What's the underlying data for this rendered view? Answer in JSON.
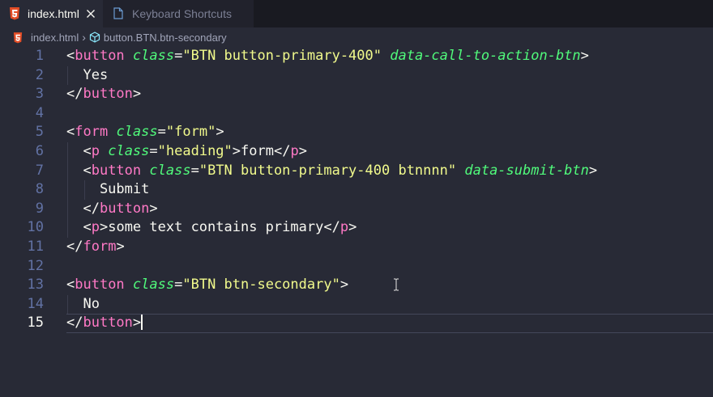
{
  "tabs": [
    {
      "label": "index.html",
      "active": true,
      "icon": "html5-icon"
    },
    {
      "label": "Keyboard Shortcuts",
      "active": false,
      "icon": "file-icon"
    }
  ],
  "breadcrumb": {
    "file": "index.html",
    "symbol": "button.BTN.btn-secondary"
  },
  "editor": {
    "current_line": 15,
    "lines": [
      {
        "n": "1",
        "tokens": [
          [
            "p",
            "<"
          ],
          [
            "tag",
            "button"
          ],
          [
            "p",
            " "
          ],
          [
            "attr",
            "class"
          ],
          [
            "p",
            "="
          ],
          [
            "str",
            "\"BTN button-primary-400\""
          ],
          [
            "p",
            " "
          ],
          [
            "attr",
            "data-call-to-action-btn"
          ],
          [
            "p",
            ">"
          ]
        ]
      },
      {
        "n": "2",
        "tokens": [
          [
            "text",
            "  Yes"
          ]
        ]
      },
      {
        "n": "3",
        "tokens": [
          [
            "p",
            "</"
          ],
          [
            "tag",
            "button"
          ],
          [
            "p",
            ">"
          ]
        ]
      },
      {
        "n": "4",
        "tokens": []
      },
      {
        "n": "5",
        "tokens": [
          [
            "p",
            "<"
          ],
          [
            "tag",
            "form"
          ],
          [
            "p",
            " "
          ],
          [
            "attr",
            "class"
          ],
          [
            "p",
            "="
          ],
          [
            "str",
            "\"form\""
          ],
          [
            "p",
            ">"
          ]
        ]
      },
      {
        "n": "6",
        "tokens": [
          [
            "p",
            "  <"
          ],
          [
            "tag",
            "p"
          ],
          [
            "p",
            " "
          ],
          [
            "attr",
            "class"
          ],
          [
            "p",
            "="
          ],
          [
            "str",
            "\"heading\""
          ],
          [
            "p",
            ">"
          ],
          [
            "text",
            "form"
          ],
          [
            "p",
            "</"
          ],
          [
            "tag",
            "p"
          ],
          [
            "p",
            ">"
          ]
        ]
      },
      {
        "n": "7",
        "tokens": [
          [
            "p",
            "  <"
          ],
          [
            "tag",
            "button"
          ],
          [
            "p",
            " "
          ],
          [
            "attr",
            "class"
          ],
          [
            "p",
            "="
          ],
          [
            "str",
            "\"BTN button-primary-400 btnnnn\""
          ],
          [
            "p",
            " "
          ],
          [
            "attr",
            "data-submit-btn"
          ],
          [
            "p",
            ">"
          ]
        ]
      },
      {
        "n": "8",
        "tokens": [
          [
            "text",
            "    Submit"
          ]
        ]
      },
      {
        "n": "9",
        "tokens": [
          [
            "p",
            "  </"
          ],
          [
            "tag",
            "button"
          ],
          [
            "p",
            ">"
          ]
        ]
      },
      {
        "n": "10",
        "tokens": [
          [
            "p",
            "  <"
          ],
          [
            "tag",
            "p"
          ],
          [
            "p",
            ">"
          ],
          [
            "text",
            "some text contains primary"
          ],
          [
            "p",
            "</"
          ],
          [
            "tag",
            "p"
          ],
          [
            "p",
            ">"
          ]
        ]
      },
      {
        "n": "11",
        "tokens": [
          [
            "p",
            "</"
          ],
          [
            "tag",
            "form"
          ],
          [
            "p",
            ">"
          ]
        ]
      },
      {
        "n": "12",
        "tokens": []
      },
      {
        "n": "13",
        "tokens": [
          [
            "p",
            "<"
          ],
          [
            "tag",
            "button"
          ],
          [
            "p",
            " "
          ],
          [
            "attr",
            "class"
          ],
          [
            "p",
            "="
          ],
          [
            "str",
            "\"BTN btn-secondary\""
          ],
          [
            "p",
            ">"
          ]
        ]
      },
      {
        "n": "14",
        "tokens": [
          [
            "text",
            "  No"
          ]
        ]
      },
      {
        "n": "15",
        "tokens": [
          [
            "p",
            "</"
          ],
          [
            "tag",
            "button"
          ],
          [
            "p",
            ">"
          ]
        ]
      }
    ]
  },
  "colors": {
    "background": "#282a36",
    "tag": "#ff79c6",
    "attribute": "#50fa7b",
    "string": "#f1fa8c",
    "line_number": "#6272a4"
  }
}
